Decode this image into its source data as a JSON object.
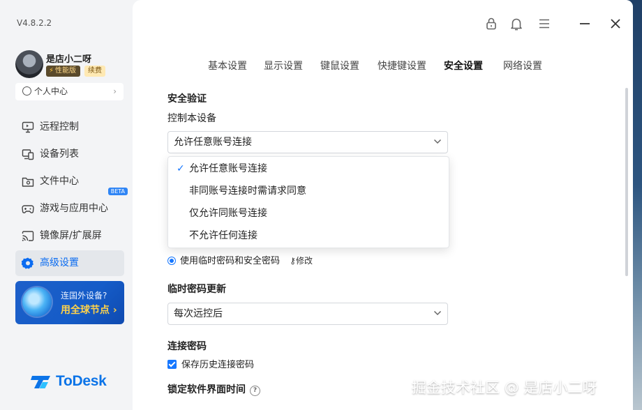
{
  "app": {
    "version": "V4.8.2.2",
    "brand": "ToDesk"
  },
  "user": {
    "name": "是店小二呀",
    "tier_badge": "性能版",
    "renew_badge": "续费",
    "profile_label": "个人中心"
  },
  "sidebar": {
    "items": [
      {
        "label": "远程控制",
        "icon": "monitor-icon"
      },
      {
        "label": "设备列表",
        "icon": "devices-icon"
      },
      {
        "label": "文件中心",
        "icon": "folder-icon"
      },
      {
        "label": "游戏与应用中心",
        "icon": "gamepad-icon",
        "badge": "BETA"
      },
      {
        "label": "镜像屏/扩展屏",
        "icon": "cast-icon"
      },
      {
        "label": "高级设置",
        "icon": "gear-icon",
        "active": true
      }
    ],
    "promo": {
      "line1": "连国外设备?",
      "line2": "用全球节点 ›"
    }
  },
  "tabs": [
    {
      "label": "基本设置"
    },
    {
      "label": "显示设置"
    },
    {
      "label": "键鼠设置"
    },
    {
      "label": "快捷键设置"
    },
    {
      "label": "安全设置",
      "active": true
    },
    {
      "label": "网络设置"
    }
  ],
  "security": {
    "section_title": "安全验证",
    "control_label": "控制本设备",
    "control_value": "允许任意账号连接",
    "dropdown_options": [
      {
        "label": "允许任意账号连接",
        "selected": true
      },
      {
        "label": "非同账号连接时需请求同意"
      },
      {
        "label": "仅允许同账号连接"
      },
      {
        "label": "不允许任何连接"
      }
    ],
    "radio_label": "使用临时密码和安全密码",
    "modify_label": "修改",
    "temp_pw_title": "临时密码更新",
    "temp_pw_value": "每次远控后",
    "conn_pw_title": "连接密码",
    "save_history_label": "保存历史连接密码",
    "lock_title": "锁定软件界面时间"
  },
  "colors": {
    "accent": "#1677ff",
    "brand": "#0c74e8",
    "promo_bg": "#155cc8",
    "promo_highlight": "#ffd24a"
  },
  "watermark": "掘金技术社区 @ 是店小二呀"
}
